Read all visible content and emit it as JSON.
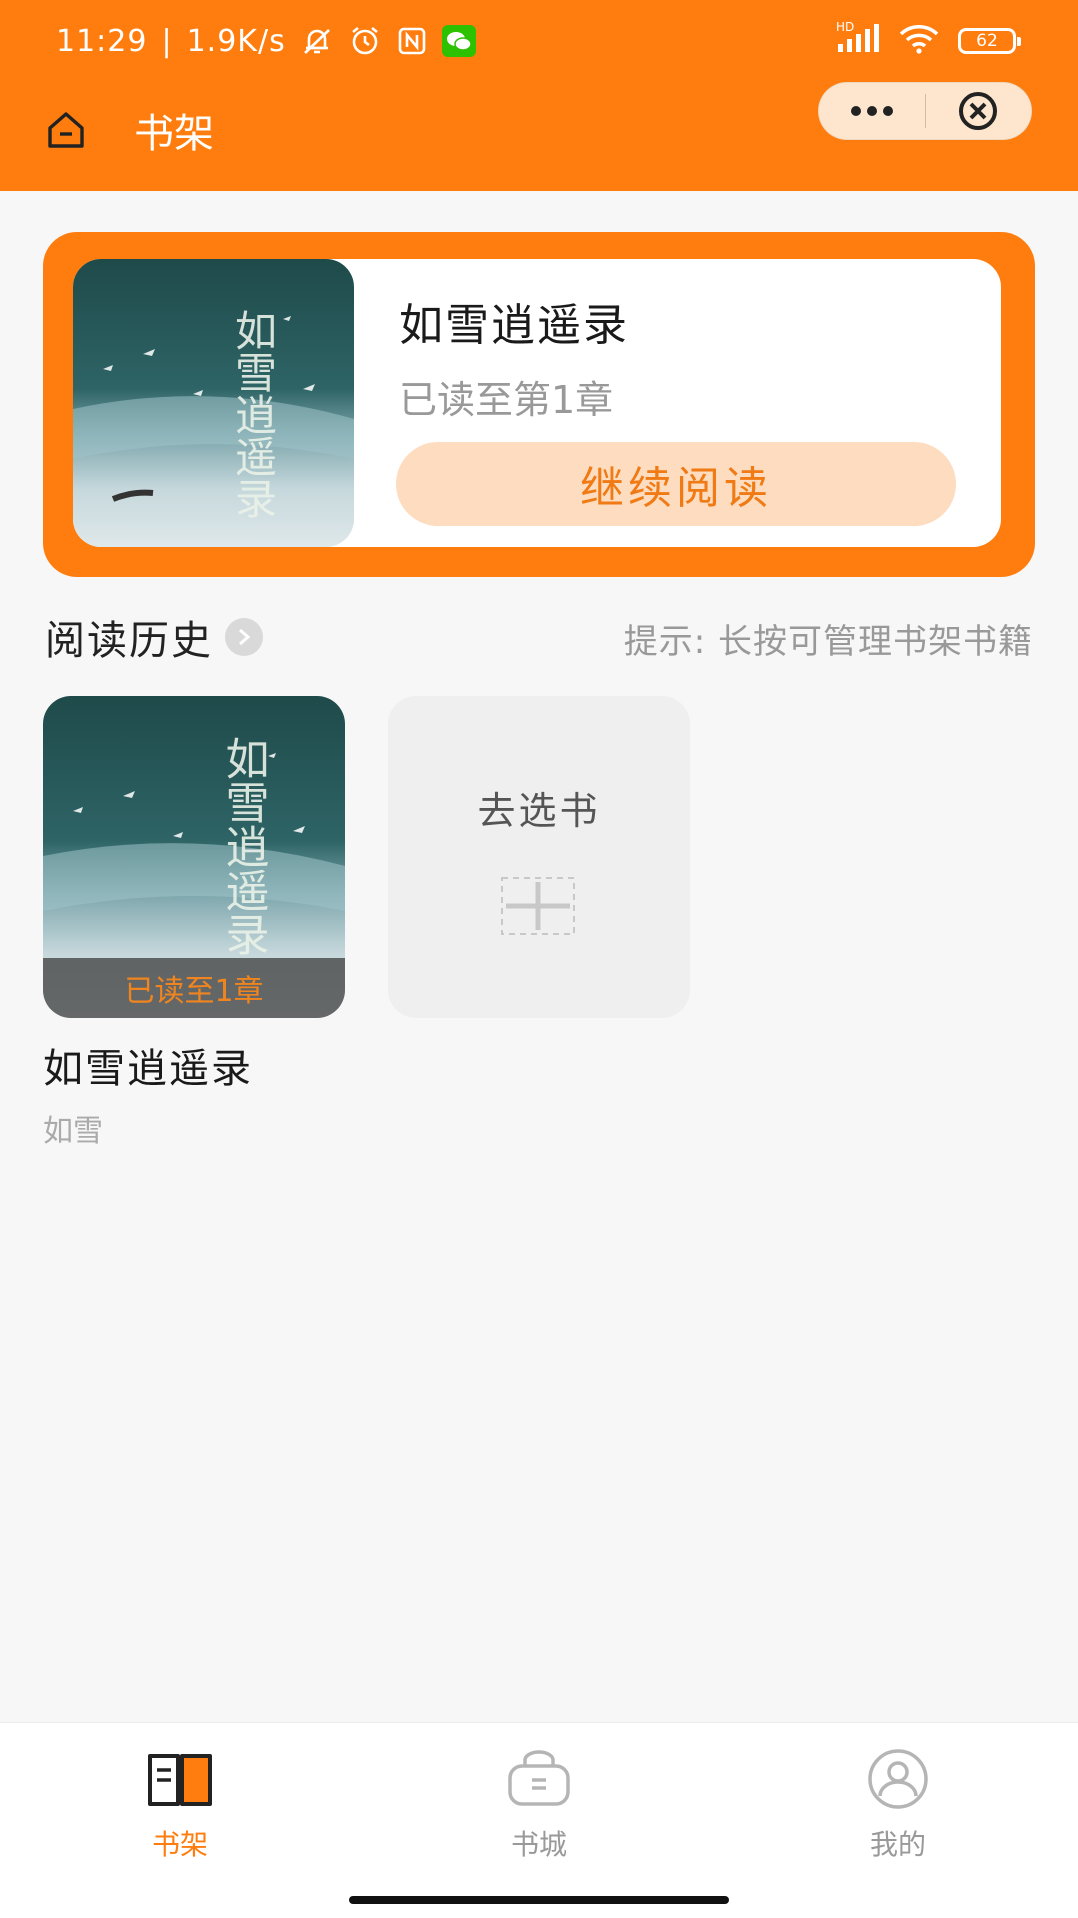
{
  "status_bar": {
    "time": "11:29",
    "network_speed": "1.9K/s",
    "battery": "62",
    "hd_label": "HD"
  },
  "nav": {
    "title": "书架"
  },
  "current_book": {
    "title": "如雪逍遥录",
    "progress_text": "已读至第1章",
    "continue_label": "继续阅读",
    "cover_chars": "如雪逍遥录"
  },
  "history": {
    "title": "阅读历史",
    "tip": "提示: 长按可管理书架书籍",
    "items": [
      {
        "title": "如雪逍遥录",
        "author": "如雪",
        "progress_badge": "已读至1章"
      }
    ],
    "add_label": "去选书"
  },
  "tabs": [
    {
      "label": "书架",
      "icon": "bookshelf-icon",
      "active": true
    },
    {
      "label": "书城",
      "icon": "bookstore-bag-icon",
      "active": false
    },
    {
      "label": "我的",
      "icon": "profile-icon",
      "active": false
    }
  ],
  "colors": {
    "brand": "#ff7d0e",
    "button_bg": "#fddcc0",
    "button_text": "#f07a14"
  }
}
